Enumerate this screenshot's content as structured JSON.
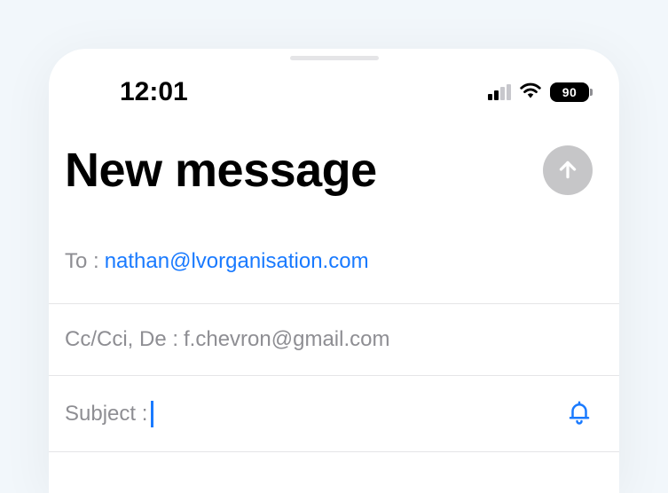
{
  "status": {
    "time": "12:01",
    "battery": "90"
  },
  "header": {
    "title": "New message"
  },
  "fields": {
    "to_label": "To :",
    "to_value": "nathan@lvorganisation.com",
    "cc_label": "Cc/Cci, De :",
    "cc_value": "f.chevron@gmail.com",
    "subject_label": "Subject :",
    "subject_value": ""
  }
}
